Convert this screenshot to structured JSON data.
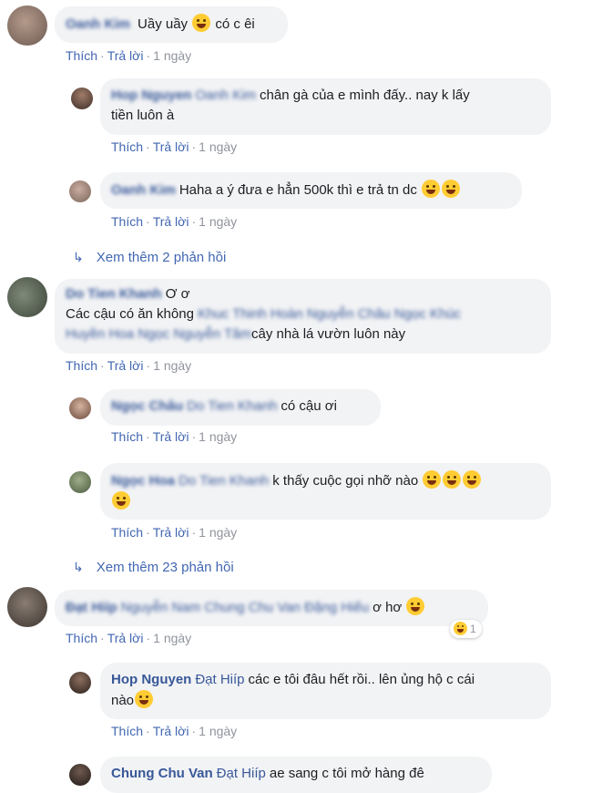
{
  "actions": {
    "like": "Thích",
    "reply": "Trả lời",
    "sep": "·",
    "time": "1 ngày"
  },
  "comments": [
    {
      "name": "Oanh Kim",
      "text": "Uầy uầy",
      "text2": "có c êi"
    },
    {
      "name": "Hop Nguyen",
      "tag": "Oanh Kim",
      "text": "chân gà của e mình đấy.. nay k lấy",
      "text2": "tiền luôn à"
    },
    {
      "name": "Oanh Kim",
      "text": "Haha a ý đưa e hẳn 500k thì e trả tn dc"
    },
    {
      "name": "Do Tien Khanh",
      "text": "Ơ ơ",
      "line2_text": "Các cậu có ăn không",
      "tags_a": "Khuc Thinh Hoàn Nguyễn Châu Ngọc Khúc",
      "tags_b": "Huyền Hoa Ngọc Nguyễn Tâm",
      "line3_text": "cây nhà lá vườn luôn này"
    },
    {
      "name": "Ngọc Châu",
      "tag": "Do Tien Khanh",
      "text": "có cậu ơi"
    },
    {
      "name": "Ngọc Hoa",
      "tag": "Do Tien Khanh",
      "text": "k thấy cuộc gọi nhỡ nào"
    },
    {
      "name": "Đạt Hiíp",
      "tags": "Nguyễn Nam Chung Chu Van Đặng Hiếu",
      "text": "ơ hơ",
      "reaction_count": "1"
    },
    {
      "name": "Hop Nguyen",
      "tag": "Đạt Hiíp",
      "text": "các e tôi đâu hết rồi.. lên ủng hộ c cái",
      "text2": "nào"
    },
    {
      "name": "Chung Chu Van",
      "tag": "Đạt Hiíp",
      "text": "ae sang c tôi mở hàng đê"
    }
  ],
  "more_replies": [
    {
      "label": "Xem thêm 2 phản hồi"
    },
    {
      "label": "Xem thêm 23 phản hồi"
    }
  ],
  "colors": {
    "link": "#4267b2",
    "name": "#385898",
    "bubble": "#f2f3f5",
    "meta": "#90949c"
  }
}
